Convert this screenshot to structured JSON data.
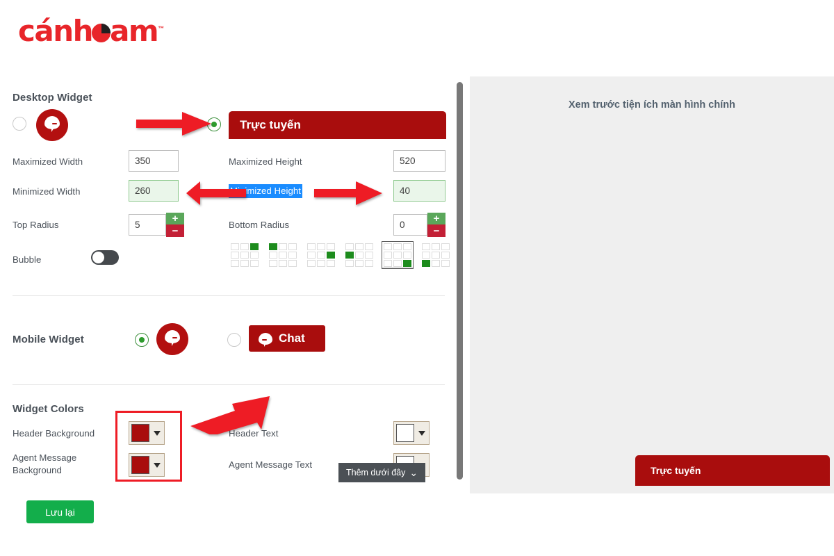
{
  "brand": {
    "logo_text_part1": "c",
    "logo_text_accent": "á",
    "logo_text_part2": "nh",
    "logo_text_part3": "am",
    "logo_tm": "™",
    "primary_red": "#e8252a",
    "widget_red": "#a90d0d",
    "green": "#13ae4b"
  },
  "desktop": {
    "section_title": "Desktop Widget",
    "style_option_circle_selected": false,
    "style_option_bar_selected": true,
    "bar_label": "Trực tuyến",
    "fields": {
      "maximized_width": {
        "label": "Maximized Width",
        "value": "350",
        "highlight": false
      },
      "maximized_height": {
        "label": "Maximized Height",
        "value": "520",
        "highlight": false
      },
      "minimized_width": {
        "label": "Minimized Width",
        "value": "260",
        "highlight": true
      },
      "minimized_height": {
        "label": "Minimized Height",
        "value": "40",
        "highlight": true,
        "label_selected": true
      },
      "top_radius": {
        "label": "Top Radius",
        "value": "5"
      },
      "bottom_radius": {
        "label": "Bottom Radius",
        "value": "0"
      }
    },
    "spinner": {
      "increment": "+",
      "decrement": "−"
    },
    "bubble": {
      "label": "Bubble",
      "enabled": false
    },
    "positions": [
      {
        "name": "top-right",
        "cell": 2,
        "selected": false
      },
      {
        "name": "top-left",
        "cell": 0,
        "selected": false
      },
      {
        "name": "middle-right",
        "cell": 5,
        "selected": false
      },
      {
        "name": "middle-left",
        "cell": 3,
        "selected": false
      },
      {
        "name": "bottom-right",
        "cell": 8,
        "selected": true
      },
      {
        "name": "bottom-left",
        "cell": 6,
        "selected": false
      }
    ]
  },
  "mobile": {
    "section_title": "Mobile Widget",
    "option_circle_selected": true,
    "option_chat_selected": false,
    "chat_label": "Chat"
  },
  "colors_section": {
    "section_title": "Widget Colors",
    "rows": [
      {
        "label": "Header Background",
        "swatch": "#a90d0d",
        "highlighted": true
      },
      {
        "label": "Header Text",
        "swatch": "#ffffff",
        "highlighted": false
      },
      {
        "label": "Agent Message Background",
        "swatch": "#a90d0d",
        "highlighted": true
      },
      {
        "label": "Agent Message Text",
        "swatch": "#ffffff",
        "highlighted": false
      }
    ]
  },
  "tooltip": {
    "text": "Thêm dưới đây",
    "chevron": "⌄"
  },
  "save": {
    "label": "Lưu lại"
  },
  "preview": {
    "title": "Xem trước tiện ích màn hình chính",
    "bar_label": "Trực tuyến"
  }
}
